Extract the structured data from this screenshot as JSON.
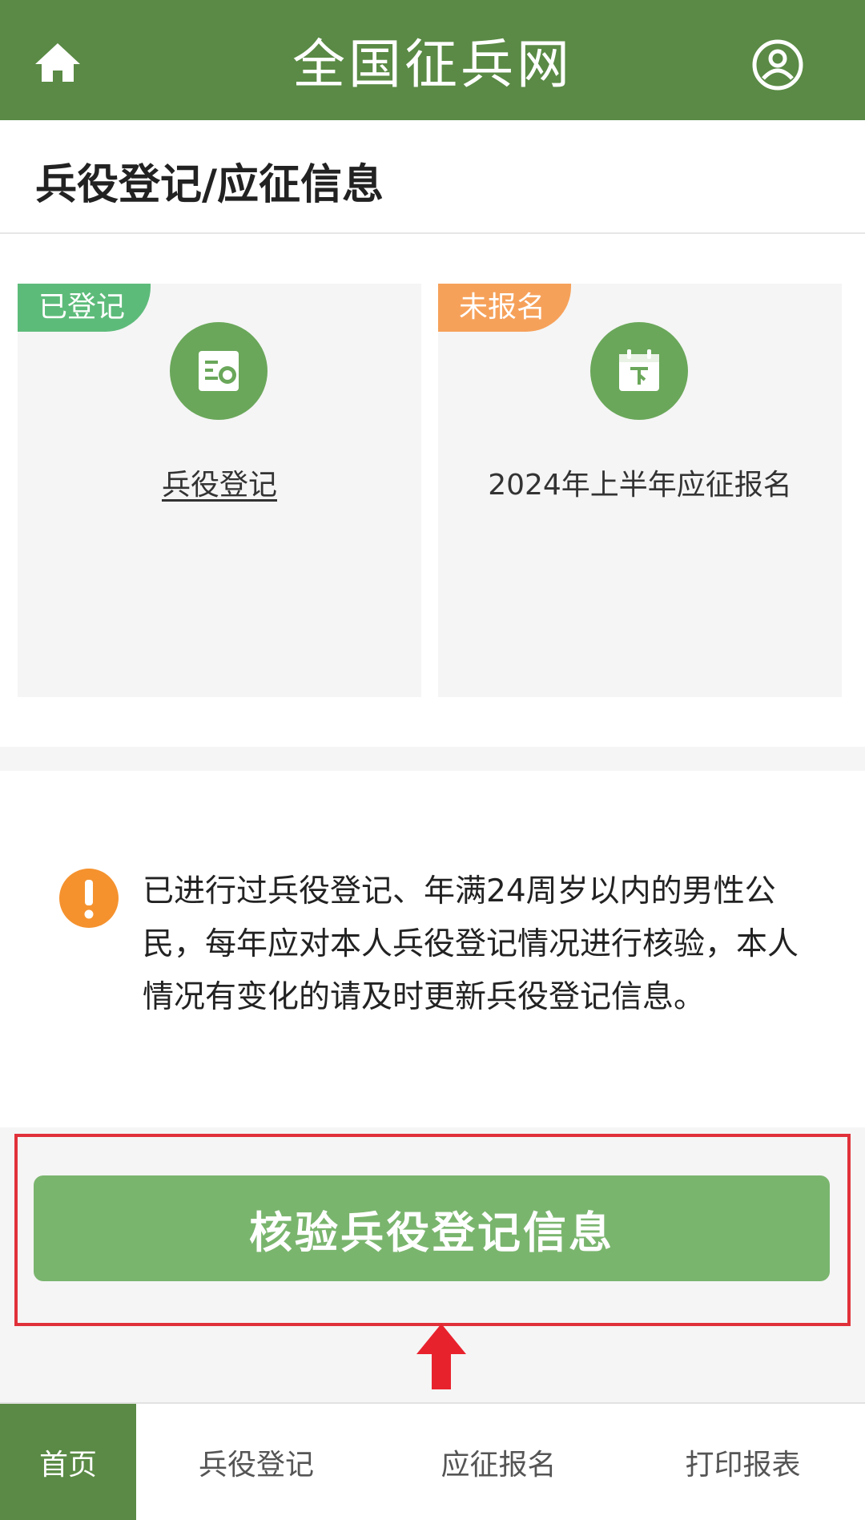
{
  "header": {
    "title": "全国征兵网",
    "home_icon": "home-icon",
    "user_icon": "user-icon"
  },
  "page": {
    "title": "兵役登记/应征信息"
  },
  "cards": [
    {
      "badge": "已登记",
      "badge_color": "#5dbb7a",
      "icon": "registration-form-icon",
      "label": "兵役登记"
    },
    {
      "badge": "未报名",
      "badge_color": "#f6a15a",
      "icon": "calendar-download-icon",
      "label": "2024年上半年应征报名"
    }
  ],
  "notice": {
    "icon": "warning-icon",
    "text": "已进行过兵役登记、年满24周岁以内的男性公民，每年应对本人兵役登记情况进行核验，本人情况有变化的请及时更新兵役登记信息。"
  },
  "verify_button": {
    "label": "核验兵役登记信息"
  },
  "annotation": {
    "box_color": "#e0313a",
    "arrow_icon": "up-arrow-icon"
  },
  "bottom_nav": {
    "items": [
      "首页",
      "兵役登记",
      "应征报名",
      "打印报表"
    ],
    "active_index": 0
  },
  "colors": {
    "primary": "#5a8a45",
    "button": "#7ab56e",
    "warning": "#f5922e"
  }
}
